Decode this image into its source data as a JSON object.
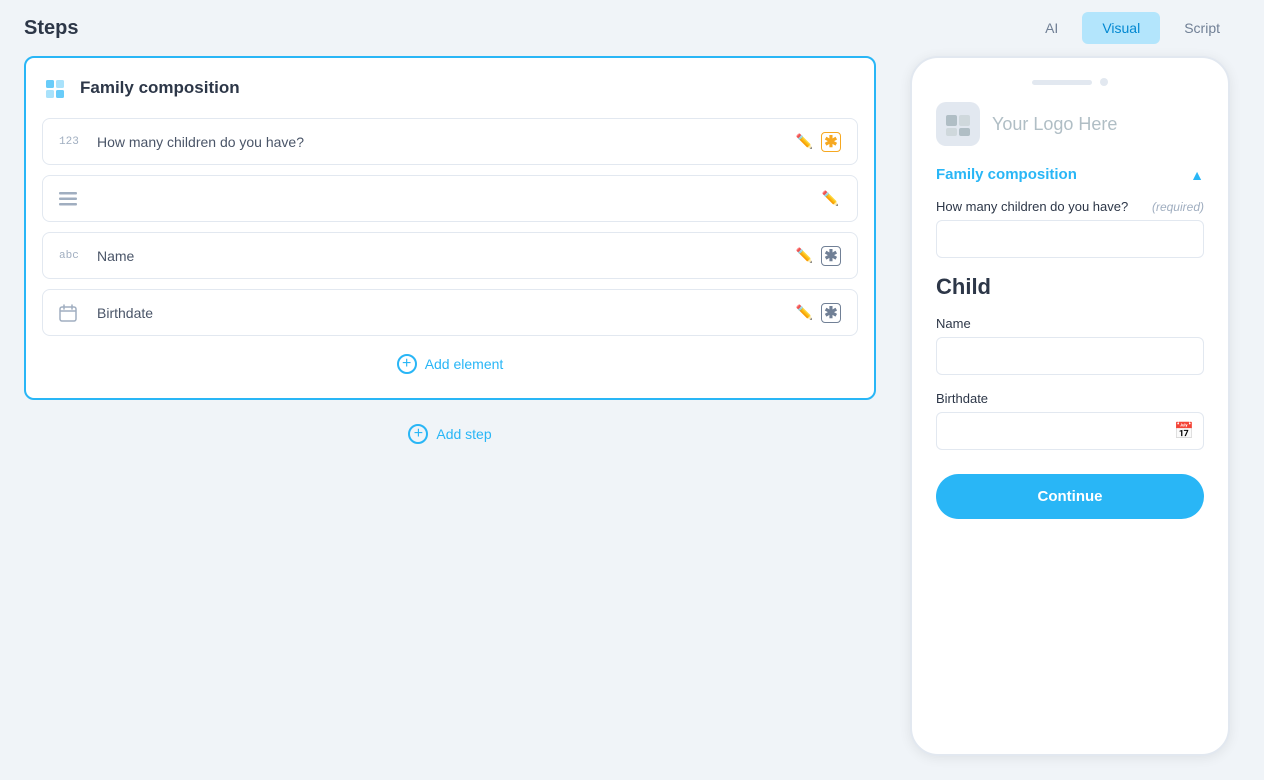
{
  "header": {
    "title": "Steps",
    "tabs": [
      {
        "id": "ai",
        "label": "AI",
        "active": false
      },
      {
        "id": "visual",
        "label": "Visual",
        "active": true
      },
      {
        "id": "script",
        "label": "Script",
        "active": false
      }
    ]
  },
  "step": {
    "title": "Family composition",
    "elements": [
      {
        "id": "children-count",
        "type": "number",
        "type_label": "123",
        "label": "How many children do you have?",
        "has_edit": true,
        "has_required": true,
        "required_color": "orange"
      },
      {
        "id": "group-element",
        "type": "list",
        "type_label": "≡",
        "label": "",
        "has_edit": true,
        "has_required": false
      },
      {
        "id": "name",
        "type": "text",
        "type_label": "abc",
        "label": "Name",
        "has_edit": true,
        "has_required": true,
        "required_color": "gray"
      },
      {
        "id": "birthdate",
        "type": "date",
        "type_label": "▦",
        "label": "Birthdate",
        "has_edit": true,
        "has_required": true,
        "required_color": "gray"
      }
    ],
    "add_element_label": "Add element",
    "add_step_label": "Add step"
  },
  "preview": {
    "logo_text": "Your Logo Here",
    "section_title": "Family composition",
    "children_field": {
      "label": "How many children do you have?",
      "required_label": "(required)"
    },
    "child_heading": "Child",
    "name_field": {
      "label": "Name"
    },
    "birthdate_field": {
      "label": "Birthdate"
    },
    "continue_btn": "Continue"
  }
}
